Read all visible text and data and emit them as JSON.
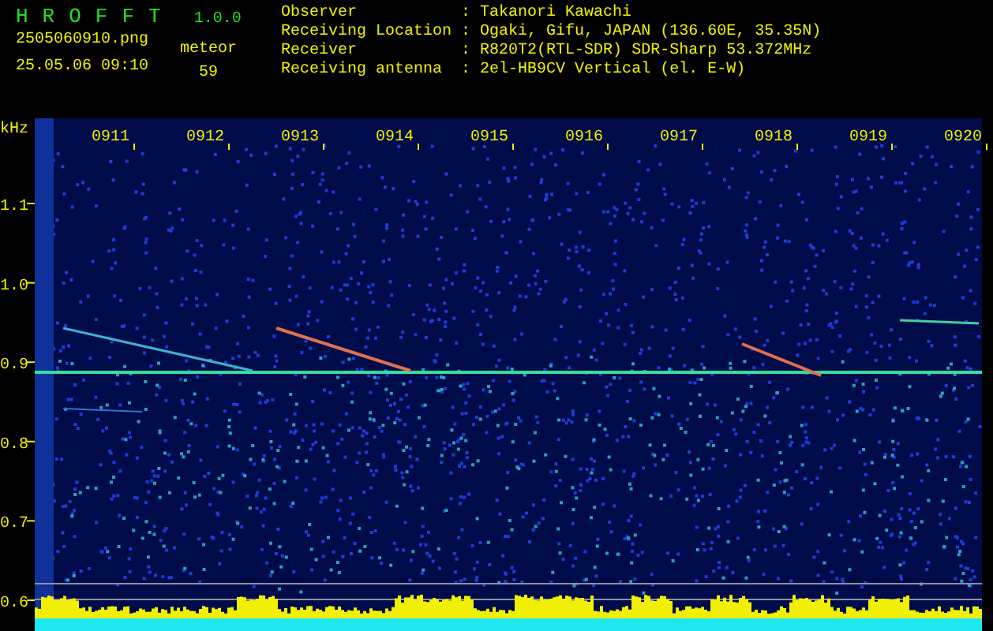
{
  "header": {
    "app_name": "HROFFT",
    "version": "1.0.0",
    "filename": "2505060910.png",
    "timestamp": "25.05.06 09:10",
    "counter_label": "meteor",
    "counter_value": "59",
    "info": [
      {
        "label": "Observer",
        "separator": ":",
        "value": "Takanori Kawachi"
      },
      {
        "label": "Receiving Location",
        "separator": ":",
        "value": "Ogaki, Gifu, JAPAN (136.60E, 35.35N)"
      },
      {
        "label": "Receiver",
        "separator": ":",
        "value": "R820T2(RTL-SDR) SDR-Sharp 53.372MHz"
      },
      {
        "label": "Receiving antenna",
        "separator": ":",
        "value": "2el-HB9CV Vertical (el. E-W)"
      }
    ]
  },
  "spectrogram": {
    "unit": "kHz",
    "y_labels": [
      "1.1",
      "1.0",
      "0.9",
      "0.8",
      "0.7",
      "0.6"
    ],
    "time_labels": [
      "0911",
      "0912",
      "0913",
      "0914",
      "0915",
      "0916",
      "0917",
      "0918",
      "0919",
      "0920"
    ]
  }
}
